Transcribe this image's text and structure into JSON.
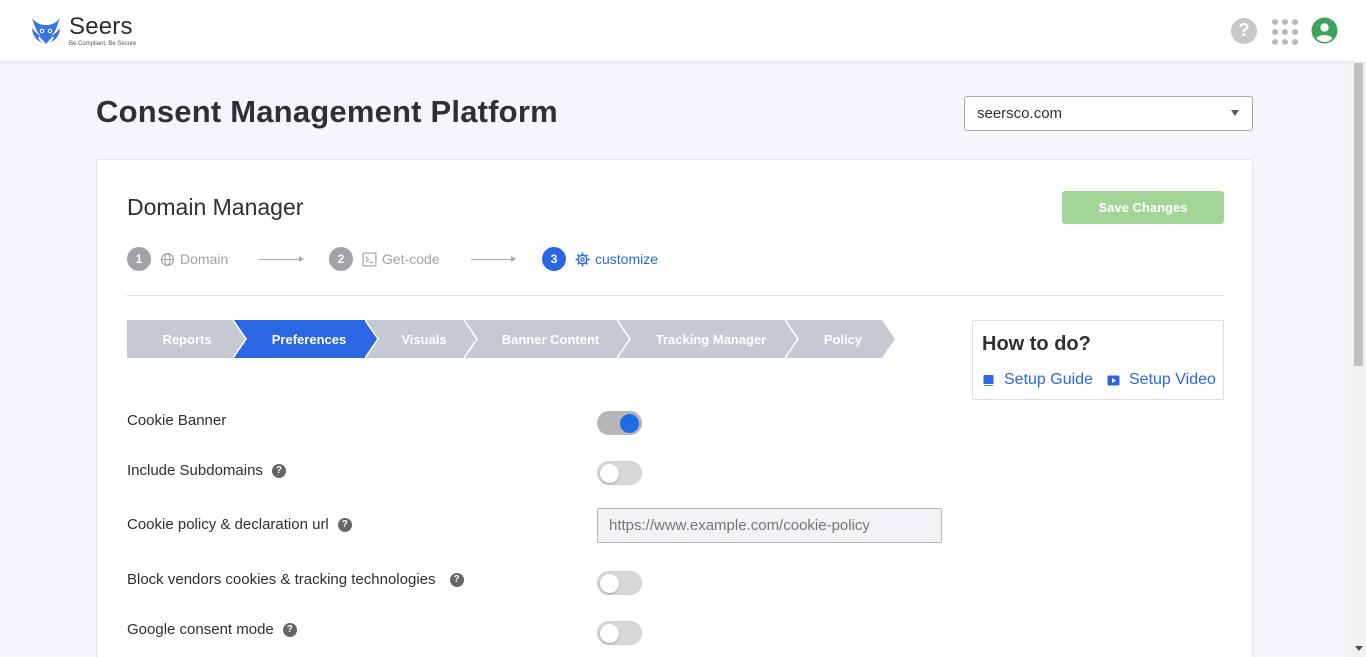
{
  "brand": {
    "name": "Seers",
    "tagline": "Be Compliant, Be Secure"
  },
  "header": {
    "title": "Consent Management Platform",
    "domain_selected": "seersco.com"
  },
  "card": {
    "title": "Domain Manager",
    "save_label": "Save Changes"
  },
  "stepper": [
    {
      "number": "1",
      "label": "Domain",
      "icon": "globe-icon",
      "state": "done"
    },
    {
      "number": "2",
      "label": "Get-code",
      "icon": "terminal-icon",
      "state": "done"
    },
    {
      "number": "3",
      "label": "customize",
      "icon": "gear-icon",
      "state": "active"
    }
  ],
  "tabs": [
    {
      "label": "Reports",
      "active": false
    },
    {
      "label": "Preferences",
      "active": true
    },
    {
      "label": "Visuals",
      "active": false
    },
    {
      "label": "Banner Content",
      "active": false
    },
    {
      "label": "Tracking Manager",
      "active": false
    },
    {
      "label": "Policy",
      "active": false
    }
  ],
  "howto": {
    "title": "How to do?",
    "guide_label": "Setup Guide",
    "video_label": "Setup Video"
  },
  "settings": {
    "cookie_banner": {
      "label": "Cookie Banner",
      "enabled": true
    },
    "include_subdomains": {
      "label": "Include Subdomains",
      "enabled": false
    },
    "cookie_policy_url": {
      "label": "Cookie policy & declaration url",
      "placeholder": "https://www.example.com/cookie-policy",
      "value": ""
    },
    "block_vendors": {
      "label": "Block vendors cookies & tracking technologies",
      "enabled": false
    },
    "google_consent_mode": {
      "label": "Google consent mode",
      "enabled": false
    }
  },
  "colors": {
    "accent": "#2b67e2",
    "tab_inactive": "#c4c9d3",
    "save_button": "#a3d596",
    "toggle_on_knob": "#1e6ce3",
    "user_icon": "#3da35d"
  }
}
